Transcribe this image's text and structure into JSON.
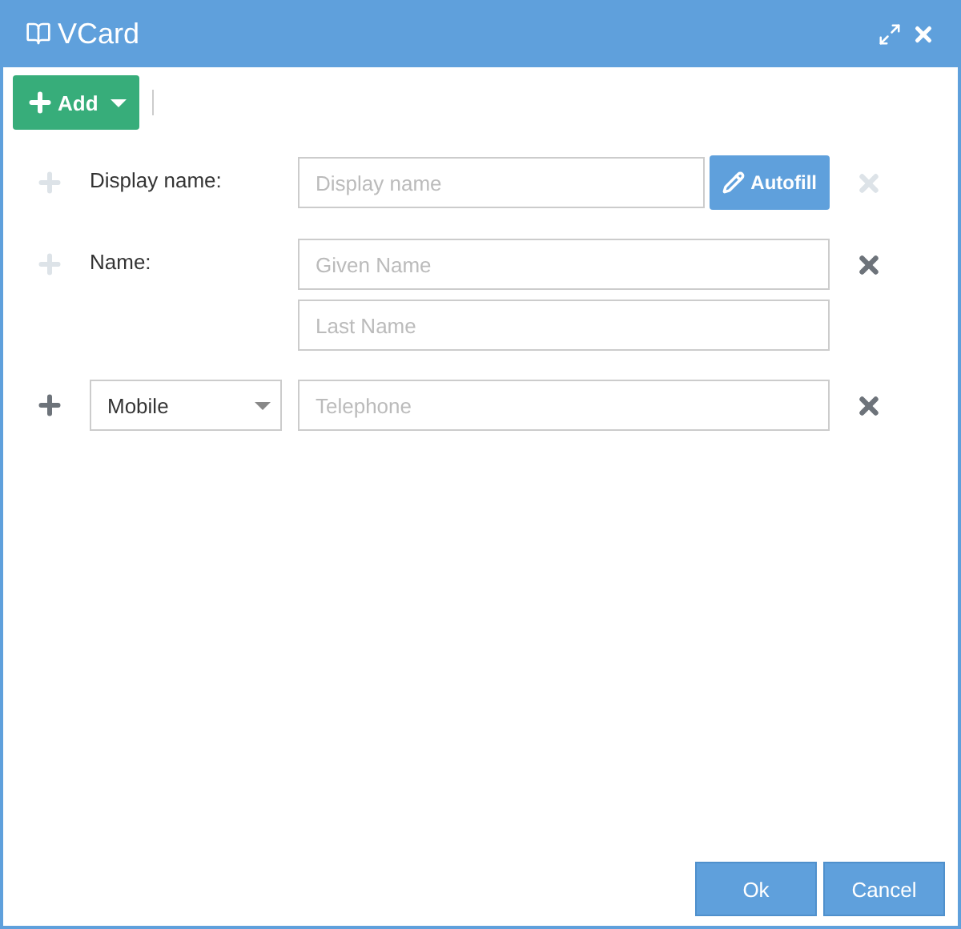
{
  "window": {
    "title": "VCard"
  },
  "toolbar": {
    "add_button": "Add"
  },
  "rows": [
    {
      "kind": "display",
      "label": "Display name:",
      "add_disabled": true,
      "placeholder": "Display name",
      "autofill": "Autofill",
      "remove_disabled": true
    },
    {
      "kind": "name",
      "label": "Name:",
      "add_disabled": true,
      "fields": [
        {
          "placeholder": "Given Name"
        },
        {
          "placeholder": "Last Name"
        }
      ],
      "remove_disabled": false
    },
    {
      "kind": "phone",
      "type": "Mobile",
      "placeholder": "Telephone",
      "add_disabled": false,
      "remove_disabled": false
    }
  ],
  "buttons": [
    "Ok",
    "Cancel"
  ]
}
